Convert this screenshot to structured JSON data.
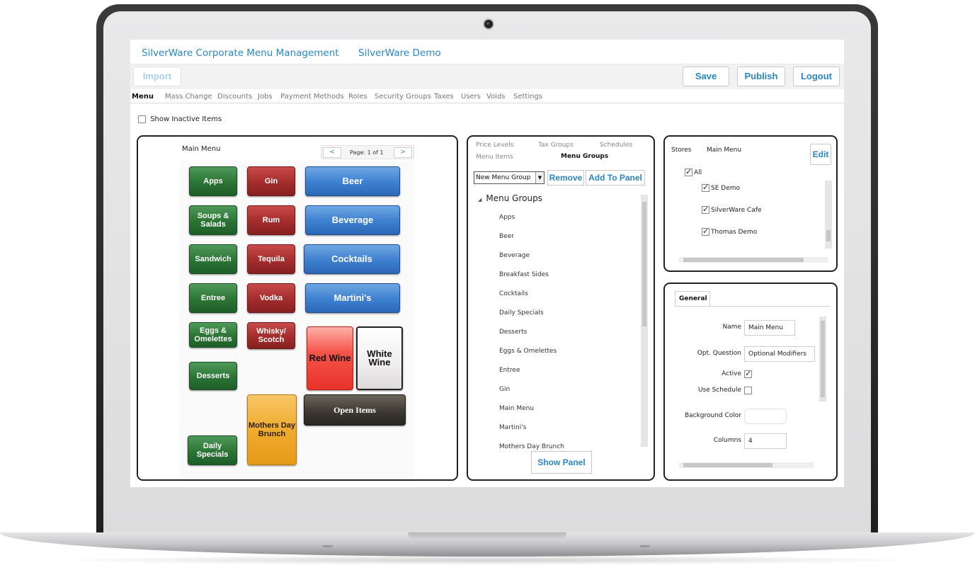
{
  "header": {
    "title": "SilverWare Corporate Menu Management",
    "company": "SilverWare Demo"
  },
  "toolbar": {
    "import_label": "Import",
    "save_label": "Save",
    "publish_label": "Publish",
    "logout_label": "Logout"
  },
  "nav_tabs": [
    "Menu",
    "Mass Change",
    "Discounts",
    "Jobs",
    "Payment Methods",
    "Roles",
    "Security Groups",
    "Taxes",
    "Users",
    "Voids",
    "Settings"
  ],
  "active_tab": "Menu",
  "show_inactive": {
    "label": "Show Inactive Items",
    "checked": false
  },
  "menu_panel": {
    "title": "Main Menu",
    "pager": {
      "prev": "<",
      "next": ">",
      "text": "Page: 1 of 1"
    },
    "buttons": {
      "apps": "Apps",
      "soups": "Soups & Salads",
      "sandwich": "Sandwich",
      "entree": "Entree",
      "eggs": "Eggs & Omelettes",
      "desserts": "Desserts",
      "daily": "Daily Specials",
      "gin": "Gin",
      "rum": "Rum",
      "tequila": "Tequila",
      "vodka": "Vodka",
      "whisky": "Whisky/ Scotch",
      "mothers": "Mothers Day Brunch",
      "beer": "Beer",
      "beverage": "Beverage",
      "cocktails": "Cocktails",
      "martinis": "Martini's",
      "red_wine": "Red Wine",
      "white_wine": "White Wine",
      "open_items": "Open Items"
    }
  },
  "groups_panel": {
    "tabs": {
      "price_levels": "Price Levels",
      "tax_groups": "Tax Groups",
      "schedules": "Schedules",
      "menu_items": "Menu Items",
      "menu_groups": "Menu Groups"
    },
    "new_group_select": "New Menu Group",
    "remove_label": "Remove",
    "add_to_panel_label": "Add To Panel",
    "tree_root": "Menu Groups",
    "groups": [
      "Apps",
      "Beer",
      "Beverage",
      "Breakfast Sides",
      "Cocktails",
      "Daily Specials",
      "Desserts",
      "Eggs & Omelettes",
      "Entree",
      "Gin",
      "Main Menu",
      "Martini's",
      "Mothers Day Brunch"
    ],
    "show_panel_label": "Show Panel"
  },
  "stores_panel": {
    "stores_label": "Stores",
    "menu_name": "Main Menu",
    "edit_label": "Edit",
    "all_label": "All",
    "stores": [
      {
        "name": "SE Demo",
        "checked": true
      },
      {
        "name": "SilverWare Cafe",
        "checked": true
      },
      {
        "name": "Thomas Demo",
        "checked": true
      }
    ]
  },
  "general_panel": {
    "tab_label": "General",
    "name_label": "Name",
    "name_value": "Main Menu",
    "opt_question_label": "Opt. Question",
    "opt_question_value": "Optional Modifiers",
    "active_label": "Active",
    "active_checked": true,
    "use_schedule_label": "Use Schedule",
    "use_schedule_checked": false,
    "background_color_label": "Background Color",
    "background_color_value": "",
    "columns_label": "Columns",
    "columns_value": "4"
  },
  "colors": {
    "accent": "#2b86c5",
    "green_button": "#2b7434",
    "red_button": "#a42c2c",
    "blue_button": "#3d7fd0",
    "orange_button": "#f0a92b"
  }
}
